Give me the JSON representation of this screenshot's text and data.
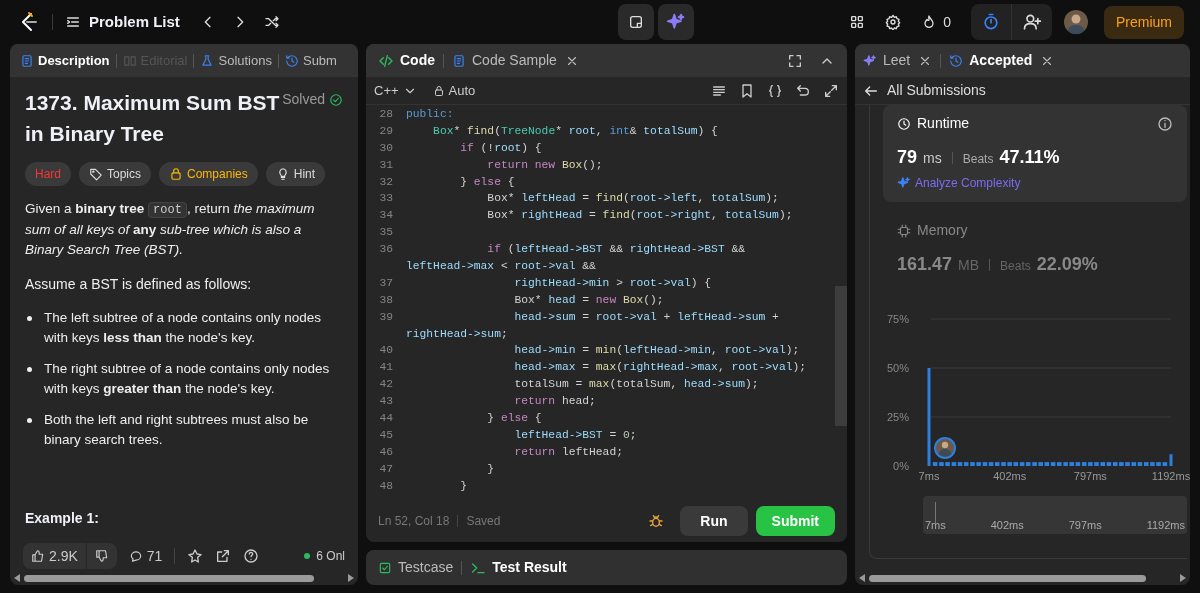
{
  "top_bar": {
    "title": "Problem List",
    "streak": "0",
    "premium": "Premium"
  },
  "description_panel": {
    "tabs": [
      {
        "label": "Description",
        "selected": true,
        "disabled": false
      },
      {
        "label": "Editorial",
        "selected": false,
        "disabled": true
      },
      {
        "label": "Solutions",
        "selected": false,
        "disabled": false
      },
      {
        "label": "Subm",
        "selected": false,
        "disabled": false
      }
    ],
    "title": "1373. Maximum Sum BST in Binary Tree",
    "status": "Solved",
    "tags": [
      {
        "kind": "difficulty",
        "label": "Hard"
      },
      {
        "kind": "topics",
        "label": "Topics"
      },
      {
        "kind": "companies",
        "label": "Companies"
      },
      {
        "kind": "hint",
        "label": "Hint"
      }
    ],
    "intro": [
      {
        "kind": "text",
        "text": "Given a **binary tree** "
      },
      {
        "kind": "code",
        "text": "root"
      },
      {
        "kind": "text",
        "text": ", return *the maximum sum of all keys of* **any** *sub-tree which is also a Binary Search Tree (BST).*"
      }
    ],
    "assume": "Assume a BST is defined as follows:",
    "bullets": [
      "The left subtree of a node contains only nodes with keys **less than** the node's key.",
      "The right subtree of a node contains only nodes with keys **greater than** the node's key.",
      "Both the left and right subtrees must also be binary search trees."
    ],
    "example_heading": "Example 1:",
    "likes": "2.9K",
    "comments": "71",
    "online": "6 Onl"
  },
  "code_panel": {
    "tabs": [
      {
        "label": "Code",
        "selected": true,
        "closable": false
      },
      {
        "label": "Code Sample",
        "selected": false,
        "closable": true
      }
    ],
    "language": "C++",
    "mode": "Auto",
    "lines": [
      {
        "number": "28",
        "tokens": [
          {
            "kind": "kw2",
            "text": "public:"
          }
        ]
      },
      {
        "number": "29",
        "tokens": [
          {
            "kind": "type",
            "text": "    Box"
          },
          {
            "kind": "p",
            "text": "* "
          },
          {
            "kind": "fn",
            "text": "find"
          },
          {
            "kind": "p",
            "text": "("
          },
          {
            "kind": "type",
            "text": "TreeNode"
          },
          {
            "kind": "p",
            "text": "* "
          },
          {
            "kind": "var",
            "text": "root"
          },
          {
            "kind": "p",
            "text": ", "
          },
          {
            "kind": "kw2",
            "text": "int"
          },
          {
            "kind": "p",
            "text": "& "
          },
          {
            "kind": "var",
            "text": "totalSum"
          },
          {
            "kind": "p",
            "text": ") {"
          }
        ]
      },
      {
        "number": "30",
        "tokens": [
          {
            "kind": "kw",
            "text": "        if"
          },
          {
            "kind": "p",
            "text": " (!"
          },
          {
            "kind": "var",
            "text": "root"
          },
          {
            "kind": "p",
            "text": ") {"
          }
        ]
      },
      {
        "number": "31",
        "tokens": [
          {
            "kind": "kw",
            "text": "            return new"
          },
          {
            "kind": "fn",
            "text": " Box"
          },
          {
            "kind": "p",
            "text": "();"
          }
        ]
      },
      {
        "number": "32",
        "tokens": [
          {
            "kind": "p",
            "text": "        } "
          },
          {
            "kind": "kw",
            "text": "else"
          },
          {
            "kind": "p",
            "text": " {"
          }
        ]
      },
      {
        "number": "33",
        "tokens": [
          {
            "kind": "p",
            "text": "            Box* "
          },
          {
            "kind": "var",
            "text": "leftHead"
          },
          {
            "kind": "p",
            "text": " = "
          },
          {
            "kind": "fn",
            "text": "find"
          },
          {
            "kind": "p",
            "text": "("
          },
          {
            "kind": "var",
            "text": "root->left"
          },
          {
            "kind": "p",
            "text": ", "
          },
          {
            "kind": "var",
            "text": "totalSum"
          },
          {
            "kind": "p",
            "text": ");"
          }
        ]
      },
      {
        "number": "34",
        "tokens": [
          {
            "kind": "p",
            "text": "            Box* "
          },
          {
            "kind": "var",
            "text": "rightHead"
          },
          {
            "kind": "p",
            "text": " = "
          },
          {
            "kind": "fn",
            "text": "find"
          },
          {
            "kind": "p",
            "text": "("
          },
          {
            "kind": "var",
            "text": "root->right"
          },
          {
            "kind": "p",
            "text": ", "
          },
          {
            "kind": "var",
            "text": "totalSum"
          },
          {
            "kind": "p",
            "text": ");"
          }
        ]
      },
      {
        "number": "35"
      },
      {
        "number": "36",
        "tokens": [
          {
            "kind": "kw",
            "text": "            if"
          },
          {
            "kind": "p",
            "text": " ("
          },
          {
            "kind": "var",
            "text": "leftHead->BST"
          },
          {
            "kind": "p",
            "text": " && "
          },
          {
            "kind": "var",
            "text": "rightHead->BST"
          },
          {
            "kind": "p",
            "text": " &&"
          }
        ],
        "wrap": [
          {
            "kind": "var",
            "text": "leftHead->max"
          },
          {
            "kind": "p",
            "text": " < "
          },
          {
            "kind": "var",
            "text": "root->val"
          },
          {
            "kind": "p",
            "text": " &&"
          }
        ]
      },
      {
        "number": "37",
        "tokens": [
          {
            "kind": "var",
            "text": "                rightHead->min"
          },
          {
            "kind": "p",
            "text": " > "
          },
          {
            "kind": "var",
            "text": "root->val"
          },
          {
            "kind": "p",
            "text": ") {"
          }
        ]
      },
      {
        "number": "38",
        "tokens": [
          {
            "kind": "p",
            "text": "                Box* "
          },
          {
            "kind": "var",
            "text": "head"
          },
          {
            "kind": "p",
            "text": " = "
          },
          {
            "kind": "kw",
            "text": "new"
          },
          {
            "kind": "fn",
            "text": " Box"
          },
          {
            "kind": "p",
            "text": "();"
          }
        ]
      },
      {
        "number": "39",
        "tokens": [
          {
            "kind": "var",
            "text": "                head->sum"
          },
          {
            "kind": "p",
            "text": " = "
          },
          {
            "kind": "var",
            "text": "root->val"
          },
          {
            "kind": "p",
            "text": " + "
          },
          {
            "kind": "var",
            "text": "leftHead->sum"
          },
          {
            "kind": "p",
            "text": " +"
          }
        ],
        "wrap": [
          {
            "kind": "var",
            "text": "rightHead->sum"
          },
          {
            "kind": "p",
            "text": ";"
          }
        ]
      },
      {
        "number": "40",
        "tokens": [
          {
            "kind": "var",
            "text": "                head->min"
          },
          {
            "kind": "p",
            "text": " = "
          },
          {
            "kind": "fn",
            "text": "min"
          },
          {
            "kind": "p",
            "text": "("
          },
          {
            "kind": "var",
            "text": "leftHead->min"
          },
          {
            "kind": "p",
            "text": ", "
          },
          {
            "kind": "var",
            "text": "root->val"
          },
          {
            "kind": "p",
            "text": ");"
          }
        ]
      },
      {
        "number": "41",
        "tokens": [
          {
            "kind": "var",
            "text": "                head->max"
          },
          {
            "kind": "p",
            "text": " = "
          },
          {
            "kind": "fn",
            "text": "max"
          },
          {
            "kind": "p",
            "text": "("
          },
          {
            "kind": "var",
            "text": "rightHead->max"
          },
          {
            "kind": "p",
            "text": ", "
          },
          {
            "kind": "var",
            "text": "root->val"
          },
          {
            "kind": "p",
            "text": ");"
          }
        ]
      },
      {
        "number": "42",
        "tokens": [
          {
            "kind": "p",
            "text": "                totalSum = "
          },
          {
            "kind": "fn",
            "text": "max"
          },
          {
            "kind": "p",
            "text": "(totalSum, "
          },
          {
            "kind": "var",
            "text": "head->sum"
          },
          {
            "kind": "p",
            "text": ");"
          }
        ]
      },
      {
        "number": "43",
        "tokens": [
          {
            "kind": "kw",
            "text": "                return"
          },
          {
            "kind": "p",
            "text": " head;"
          }
        ]
      },
      {
        "number": "44",
        "tokens": [
          {
            "kind": "p",
            "text": "            } "
          },
          {
            "kind": "kw",
            "text": "else"
          },
          {
            "kind": "p",
            "text": " {"
          }
        ]
      },
      {
        "number": "45",
        "tokens": [
          {
            "kind": "var",
            "text": "                leftHead->BST"
          },
          {
            "kind": "p",
            "text": " = "
          },
          {
            "kind": "num",
            "text": "0"
          },
          {
            "kind": "p",
            "text": ";"
          }
        ]
      },
      {
        "number": "46",
        "tokens": [
          {
            "kind": "kw",
            "text": "                return"
          },
          {
            "kind": "p",
            "text": " leftHead;"
          }
        ]
      },
      {
        "number": "47",
        "tokens": [
          {
            "kind": "p",
            "text": "            }"
          }
        ]
      },
      {
        "number": "48",
        "tokens": [
          {
            "kind": "p",
            "text": "        }"
          }
        ]
      }
    ],
    "cursor": "Ln 52, Col 18",
    "save_state": "Saved",
    "run": "Run",
    "submit": "Submit"
  },
  "result_bar": {
    "tabs": [
      {
        "label": "Testcase",
        "selected": false
      },
      {
        "label": "Test Result",
        "selected": true
      }
    ]
  },
  "result_panel": {
    "tabs": [
      {
        "label": "Leet",
        "selected": false
      },
      {
        "label": "Accepted",
        "selected": true
      }
    ],
    "back": "All Submissions",
    "metrics": [
      {
        "kind": "runtime",
        "label": "Runtime",
        "value": "79",
        "unit": "ms",
        "beats_label": "Beats",
        "beats": "47.11%",
        "selected": true,
        "action": "Analyze Complexity"
      },
      {
        "kind": "memory",
        "label": "Memory",
        "value": "161.47",
        "unit": "MB",
        "beats_label": "Beats",
        "beats": "22.09%",
        "selected": false
      }
    ],
    "chart_data": {
      "type": "bar",
      "xticks": [
        {
          "value": 7,
          "label": "7ms"
        },
        {
          "value": 402,
          "label": "402ms"
        },
        {
          "value": 797,
          "label": "797ms"
        },
        {
          "value": 1192,
          "label": "1192ms"
        }
      ],
      "yticks": [
        {
          "value": 0,
          "label": "0%"
        },
        {
          "value": 25,
          "label": "25%"
        },
        {
          "value": 50,
          "label": "50%"
        },
        {
          "value": 75,
          "label": "75%"
        }
      ],
      "ylim": [
        0,
        75
      ],
      "xlim": [
        7,
        1192
      ],
      "x": [
        7,
        37,
        68,
        98,
        129,
        159,
        189,
        220,
        250,
        281,
        311,
        341,
        372,
        402,
        432,
        463,
        493,
        524,
        554,
        584,
        615,
        645,
        676,
        706,
        736,
        767,
        797,
        827,
        858,
        888,
        919,
        949,
        979,
        1010,
        1040,
        1071,
        1101,
        1131,
        1162,
        1192
      ],
      "values": [
        50,
        2,
        2,
        2,
        2,
        2,
        2,
        2,
        2,
        2,
        2,
        2,
        2,
        2,
        2,
        2,
        2,
        2,
        2,
        2,
        2,
        2,
        2,
        2,
        2,
        2,
        2,
        2,
        2,
        2,
        2,
        2,
        2,
        2,
        2,
        2,
        2,
        2,
        2,
        6
      ]
    },
    "brush_labels": [
      "7ms",
      "402ms",
      "797ms",
      "1192ms"
    ]
  }
}
